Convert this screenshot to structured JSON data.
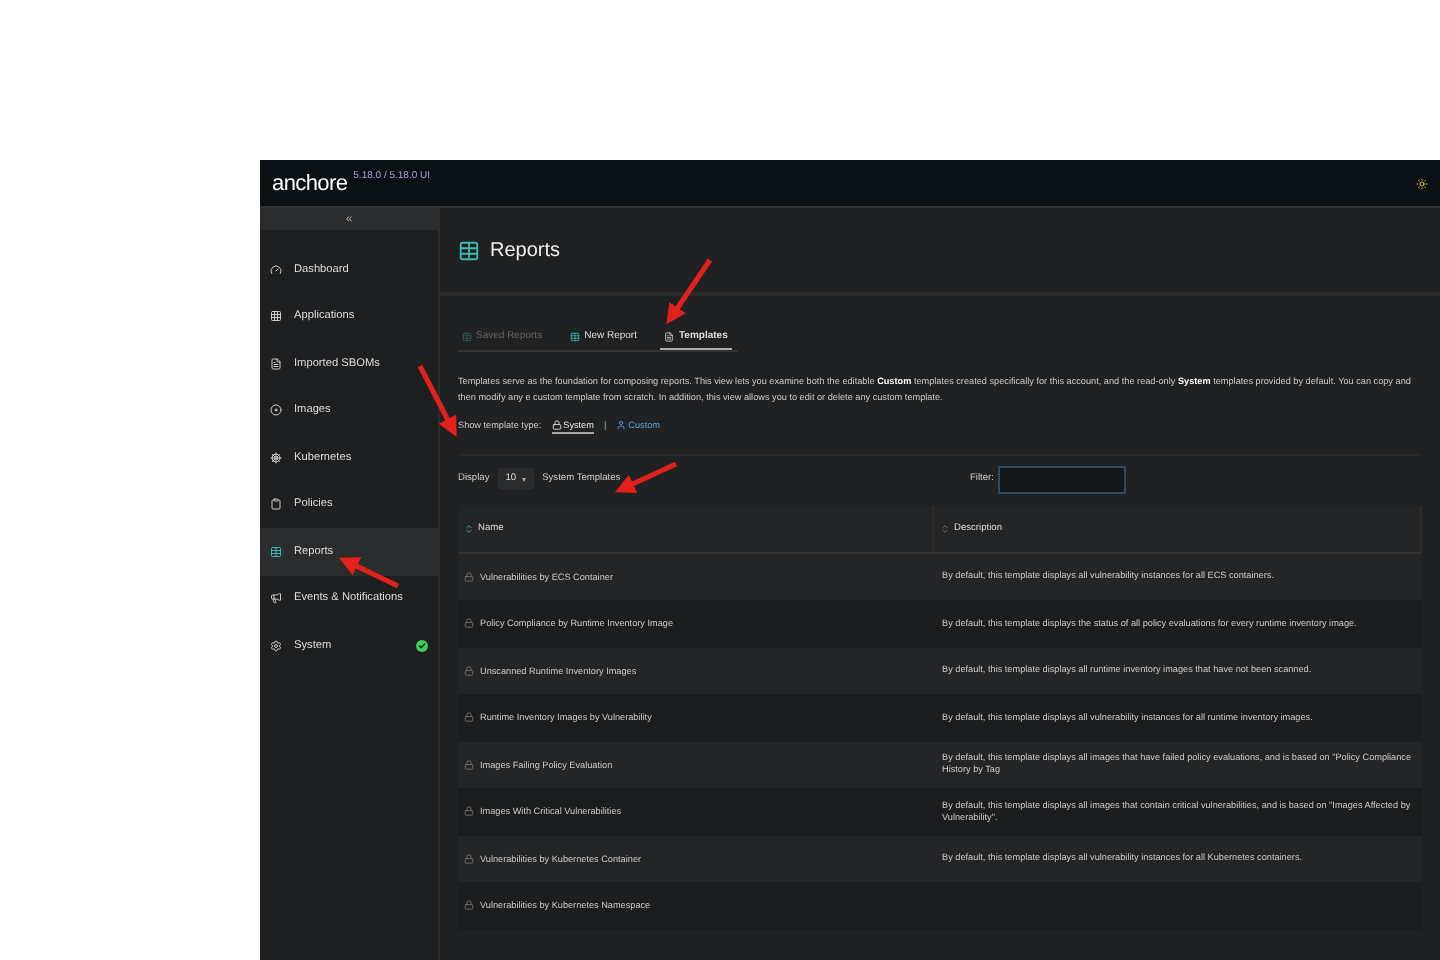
{
  "header": {
    "logo": "anchore",
    "version": "5.18.0 / 5.18.0 UI"
  },
  "sidebar": {
    "collapse": "«",
    "items": [
      {
        "label": "Dashboard",
        "selected": false
      },
      {
        "label": "Applications",
        "selected": false
      },
      {
        "label": "Imported SBOMs",
        "selected": false
      },
      {
        "label": "Images",
        "selected": false
      },
      {
        "label": "Kubernetes",
        "selected": false
      },
      {
        "label": "Policies",
        "selected": false
      },
      {
        "label": "Reports",
        "selected": true
      },
      {
        "label": "Events & Notifications",
        "selected": false
      },
      {
        "label": "System",
        "selected": false,
        "ok": true
      }
    ]
  },
  "page": {
    "title": "Reports"
  },
  "tabs": [
    {
      "label": "Saved Reports",
      "selected": false,
      "disabled": true
    },
    {
      "label": "New Report",
      "selected": false,
      "disabled": false
    },
    {
      "label": "Templates",
      "selected": true,
      "disabled": false
    }
  ],
  "intro": "Templates serve as the foundation for composing reports. This view lets you examine both the editable **Custom** templates created specifically for this account, and the read-only **System** templates provided by default. You can copy and then modify any e custom template from scratch. In addition, this view allows you to edit or delete any custom template.",
  "template_type": {
    "label": "Show template type:",
    "options": [
      {
        "label": "System",
        "selected": true
      },
      {
        "label": "Custom",
        "selected": false
      }
    ],
    "separator": "|"
  },
  "table_controls": {
    "display_label": "Display",
    "page_size": "10",
    "suffix": "System Templates",
    "filter_label": "Filter:"
  },
  "table": {
    "columns": [
      {
        "label": "Name",
        "sorted": true
      },
      {
        "label": "Description",
        "sorted": false
      }
    ],
    "rows": [
      {
        "name": "Vulnerabilities by ECS Container",
        "description": "By default, this template displays all vulnerability instances for all ECS containers."
      },
      {
        "name": "Policy Compliance by Runtime Inventory Image",
        "description": "By default, this template displays the status of all policy evaluations for every runtime inventory image."
      },
      {
        "name": "Unscanned Runtime Inventory Images",
        "description": "By default, this template displays all runtime inventory images that have not been scanned."
      },
      {
        "name": "Runtime Inventory Images by Vulnerability",
        "description": "By default, this template displays all vulnerability instances for all runtime inventory images."
      },
      {
        "name": "Images Failing Policy Evaluation",
        "description": "By default, this template displays all images that have failed policy evaluations, and is based on \"Policy Compliance History by Tag"
      },
      {
        "name": "Images With Critical Vulnerabilities",
        "description": "By default, this template displays all images that contain critical vulnerabilities, and is based on \"Images Affected by Vulnerability\"."
      },
      {
        "name": "Vulnerabilities by Kubernetes Container",
        "description": "By default, this template displays all vulnerability instances for all Kubernetes containers."
      },
      {
        "name": "Vulnerabilities by Kubernetes Namespace"
      }
    ]
  }
}
